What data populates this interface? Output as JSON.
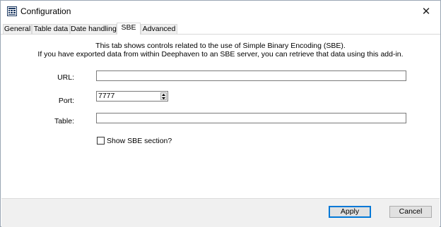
{
  "window": {
    "title": "Configuration",
    "close_glyph": "✕",
    "app_icon": "grid-icon"
  },
  "tabs": [
    {
      "label": "General",
      "active": false
    },
    {
      "label": "Table data",
      "active": false
    },
    {
      "label": "Date handling",
      "active": false
    },
    {
      "label": "SBE",
      "active": true
    },
    {
      "label": "Advanced",
      "active": false
    }
  ],
  "description": {
    "line1": "This tab shows controls related to the use of Simple Binary Encoding (SBE).",
    "line2": "If you have exported data from within Deephaven to an SBE server, you can retrieve that data using this add-in."
  },
  "form": {
    "url": {
      "label": "URL:",
      "value": ""
    },
    "port": {
      "label": "Port:",
      "value": "7777"
    },
    "table": {
      "label": "Table:",
      "value": ""
    },
    "show_sbe": {
      "label": "Show SBE section?",
      "checked": false
    }
  },
  "footer": {
    "apply_label": "Apply",
    "cancel_label": "Cancel"
  },
  "colors": {
    "accent": "#0078d7",
    "footer_bg": "#f0f0f0"
  }
}
